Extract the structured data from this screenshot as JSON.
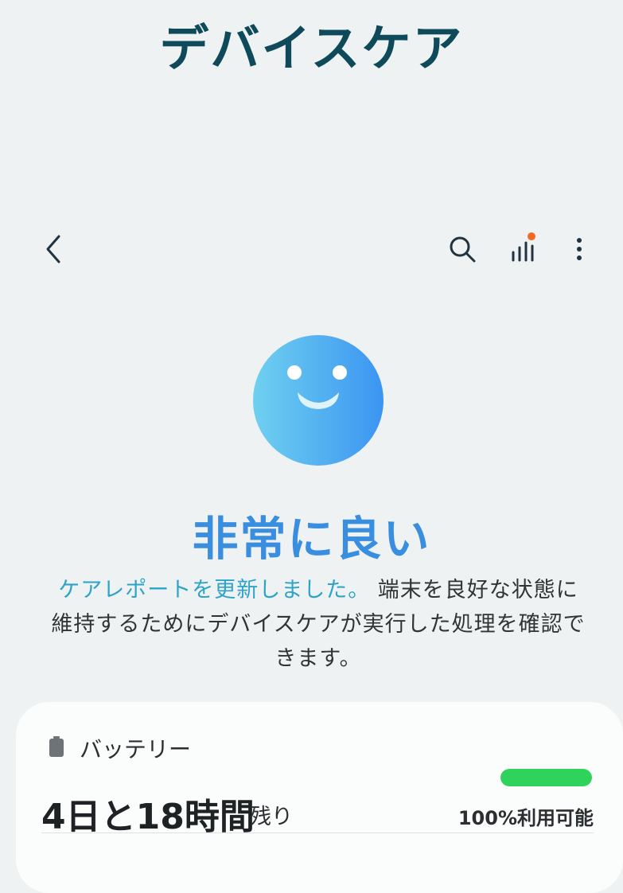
{
  "app": {
    "title": "デバイスケア"
  },
  "toolbar": {
    "icons": [
      "chevron-left-icon",
      "search-icon",
      "bar-chart-icon",
      "more-vertical-icon"
    ],
    "badge_color": "#f26a21"
  },
  "status": {
    "icon": "smiley-icon",
    "label": "非常に良い",
    "description_link": "ケアレポートを更新しました。",
    "description_text": " 端末を良好な状態に維持するためにデバイスケアが実行した処理を確認できます。",
    "accent_color": "#3a8ee0"
  },
  "battery": {
    "icon": "battery-icon",
    "title": "バッテリー",
    "time_remaining": "4日と18時間",
    "time_suffix": "残り",
    "availability": "100%利用可能",
    "level_percent": 100,
    "bar_color": "#2fd25a"
  }
}
